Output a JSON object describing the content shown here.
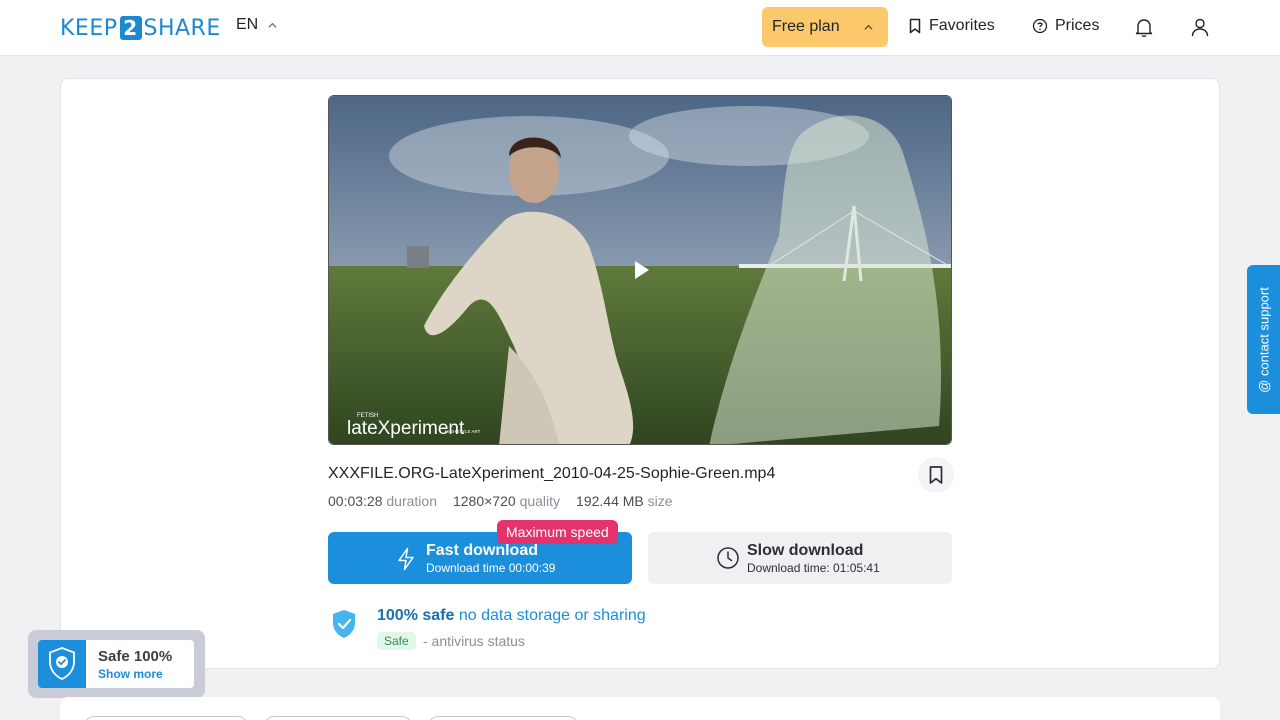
{
  "header": {
    "logo_left": "KEEP",
    "logo_num": "2",
    "logo_right": "SHARE",
    "lang": "EN",
    "plan_label": "Free plan",
    "favorites_label": "Favorites",
    "prices_label": "Prices"
  },
  "file": {
    "name": "XXXFILE.ORG-LateXperiment_2010-04-25-Sophie-Green.mp4",
    "duration": "00:03:28",
    "duration_label": "duration",
    "quality": "1280×720",
    "quality_label": "quality",
    "size": "192.44 MB",
    "size_label": "size",
    "watermark_small": "FETISH",
    "watermark_main": "lateXperiment",
    "watermark_sub": "HIGHSTYLE ART"
  },
  "download": {
    "fast_title": "Fast download",
    "fast_sub": "Download time 00:00:39",
    "max_speed_badge": "Maximum speed",
    "slow_title": "Slow download",
    "slow_sub": "Download time: 01:05:41"
  },
  "safety": {
    "bold": "100% safe",
    "text": "no data storage or sharing",
    "badge": "Safe",
    "antivirus": "- antivirus status"
  },
  "support_tab": "@ contact support",
  "safe_popup": {
    "title": "Safe 100%",
    "more": "Show more"
  },
  "colors": {
    "accent": "#1b8fdc",
    "plan": "#fbc86c",
    "badge": "#e3336a"
  }
}
